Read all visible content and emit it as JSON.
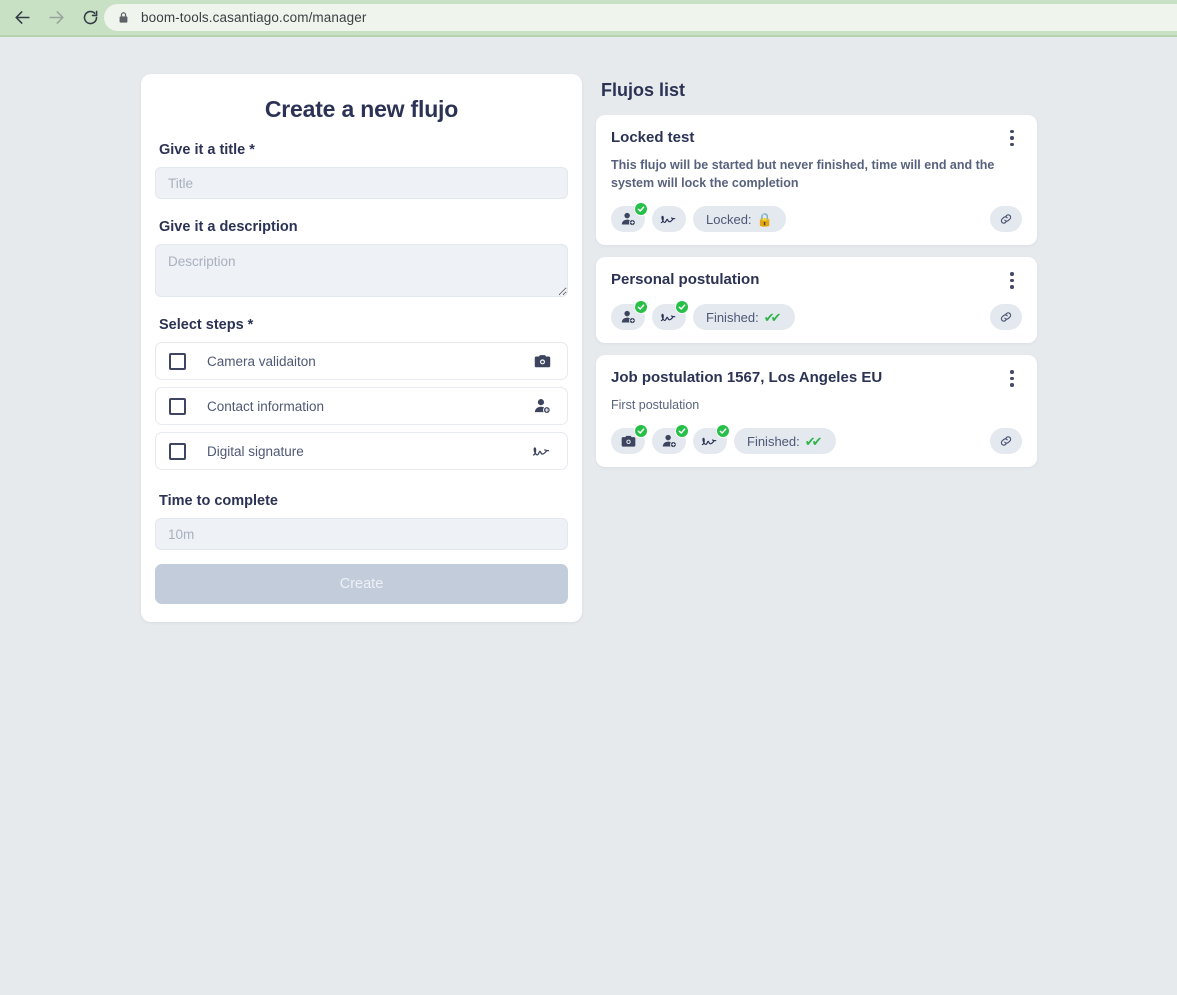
{
  "browser": {
    "back_icon": "arrow-left-icon",
    "forward_icon": "arrow-right-icon",
    "reload_icon": "reload-icon",
    "lock_icon": "lock-icon",
    "url": "boom-tools.casantiago.com/manager",
    "toolbar_color": "#c8e0c4",
    "omnibox_color": "#eff5ed"
  },
  "theme": {
    "page_background": "#e6eaed",
    "card_background": "#ffffff",
    "text_dark": "#2b3254",
    "text_muted": "#58627c",
    "input_background": "#eef1f6",
    "badge_background": "#e4e9ef",
    "success_green": "#26c048",
    "disabled_button": "#c3ccdb"
  },
  "form": {
    "title": "Create a new flujo",
    "title_field": {
      "label": "Give it a title *",
      "placeholder": "Title",
      "value": ""
    },
    "description_field": {
      "label": "Give it a description",
      "placeholder": "Description",
      "value": ""
    },
    "steps_label": "Select steps *",
    "steps": [
      {
        "label": "Camera validaiton",
        "icon": "camera-icon",
        "checked": false
      },
      {
        "label": "Contact information",
        "icon": "person-add-icon",
        "checked": false
      },
      {
        "label": "Digital signature",
        "icon": "signature-icon",
        "checked": false
      }
    ],
    "time_field": {
      "label": "Time to complete",
      "placeholder": "10m",
      "value": ""
    },
    "submit_label": "Create",
    "submit_disabled": true
  },
  "flujos": {
    "title": "Flujos list",
    "menu_icon": "kebab-menu-icon",
    "link_icon": "link-icon",
    "items": [
      {
        "title": "Locked test",
        "description": "This flujo will be started but never finished, time will end and the system will lock the completion",
        "description_bold": true,
        "badges": [
          {
            "icon": "person-add-icon",
            "completed": true
          },
          {
            "icon": "signature-icon",
            "completed": false
          }
        ],
        "status_label": "Locked:",
        "status_emoji": "🔒",
        "status_type": "locked"
      },
      {
        "title": "Personal postulation",
        "description": "",
        "description_bold": false,
        "badges": [
          {
            "icon": "person-add-icon",
            "completed": true
          },
          {
            "icon": "signature-icon",
            "completed": true
          }
        ],
        "status_label": "Finished:",
        "status_emoji": "✔✔",
        "status_type": "finished"
      },
      {
        "title": "Job postulation 1567, Los Angeles EU",
        "description": "First postulation",
        "description_bold": false,
        "badges": [
          {
            "icon": "camera-icon",
            "completed": true
          },
          {
            "icon": "person-add-icon",
            "completed": true
          },
          {
            "icon": "signature-icon",
            "completed": true
          }
        ],
        "status_label": "Finished:",
        "status_emoji": "✔✔",
        "status_type": "finished"
      }
    ]
  }
}
